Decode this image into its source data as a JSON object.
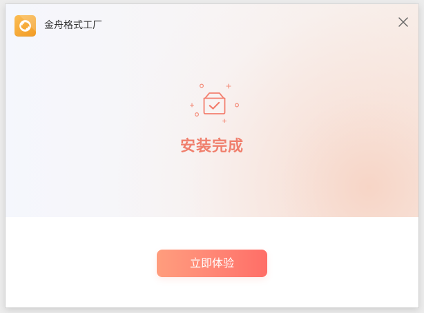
{
  "window": {
    "title": "金舟格式工厂"
  },
  "icons": {
    "logo": "app-logo-icon",
    "close": "close-icon",
    "success": "install-complete-illustration-icon"
  },
  "content": {
    "status_text": "安装完成",
    "primary_button_label": "立即体验"
  },
  "colors": {
    "accent": "#f07f6d",
    "button_start": "#ff9d7d",
    "button_end": "#ff6e67",
    "logo_orange": "#f5a42f"
  }
}
